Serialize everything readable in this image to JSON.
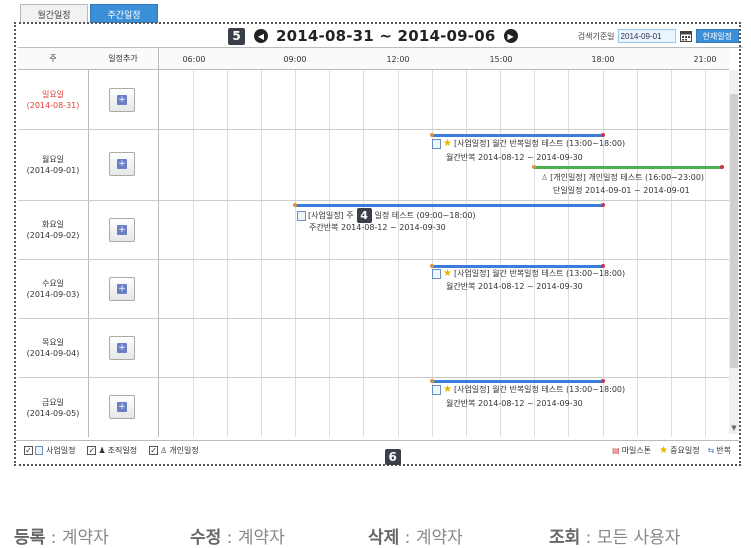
{
  "tabs": [
    {
      "label": "월간일정",
      "active": false
    },
    {
      "label": "주간일정",
      "active": true
    }
  ],
  "header": {
    "marker": "5",
    "prev_icon": "prev-arrow-icon",
    "range": "2014-08-31 ~ 2014-09-06",
    "next_icon": "next-arrow-icon",
    "search_label": "검색기준일",
    "search_value": "2014-09-01",
    "today_button": "현재일정"
  },
  "columns": {
    "week": "주",
    "add": "일정추가",
    "hours": [
      "06:00",
      "09:00",
      "12:00",
      "15:00",
      "18:00",
      "21:00"
    ]
  },
  "days": [
    {
      "name": "일요일",
      "date": "(2014-08-31)",
      "sunday": true
    },
    {
      "name": "월요일",
      "date": "(2014-09-01)",
      "sunday": false
    },
    {
      "name": "화요일",
      "date": "(2014-09-02)",
      "sunday": false
    },
    {
      "name": "수요일",
      "date": "(2014-09-03)",
      "sunday": false
    },
    {
      "name": "목요일",
      "date": "(2014-09-04)",
      "sunday": false
    },
    {
      "name": "금요일",
      "date": "(2014-09-05)",
      "sunday": false
    }
  ],
  "events": {
    "mon_monthly_title": "[사업일정] 월간 반복일정 테스트 (13:00~18:00)",
    "mon_monthly_sub": "월간반복  2014-08-12 ~ 2014-09-30",
    "mon_personal_title": "[개인일정] 개인일정 테스트 (16:00~23:00)",
    "mon_personal_sub": "단일일정  2014-09-01 ~ 2014-09-01",
    "tue_weekly_title_a": "[사업일정] 주",
    "tue_weekly_title_b": "일정 테스트 (09:00~18:00)",
    "tue_weekly_sub": "주간반복  2014-08-12 ~ 2014-09-30",
    "wed_monthly_title": "[사업일정] 월간 반복일정 테스트 (13:00~18:00)",
    "wed_monthly_sub": "월간반복  2014-08-12 ~ 2014-09-30",
    "fri_monthly_title": "[사업일정] 월간 반복일정 테스트 (13:00~18:00)",
    "fri_monthly_sub": "월간반복  2014-08-12 ~ 2014-09-30"
  },
  "grid_marker": "4",
  "legend": {
    "business": "사업일정",
    "org": "조직일정",
    "personal": "개인일정",
    "milestone": "마일스톤",
    "important": "중요일정",
    "repeat": "반복",
    "marker": "6"
  },
  "footer": {
    "register_label": "등록",
    "register_value": " : 계약자",
    "edit_label": "수정",
    "edit_value": " : 계약자",
    "delete_label": "삭제",
    "delete_value": " : 계약자",
    "view_label": "조회",
    "view_value": " : 모든 사용자"
  }
}
